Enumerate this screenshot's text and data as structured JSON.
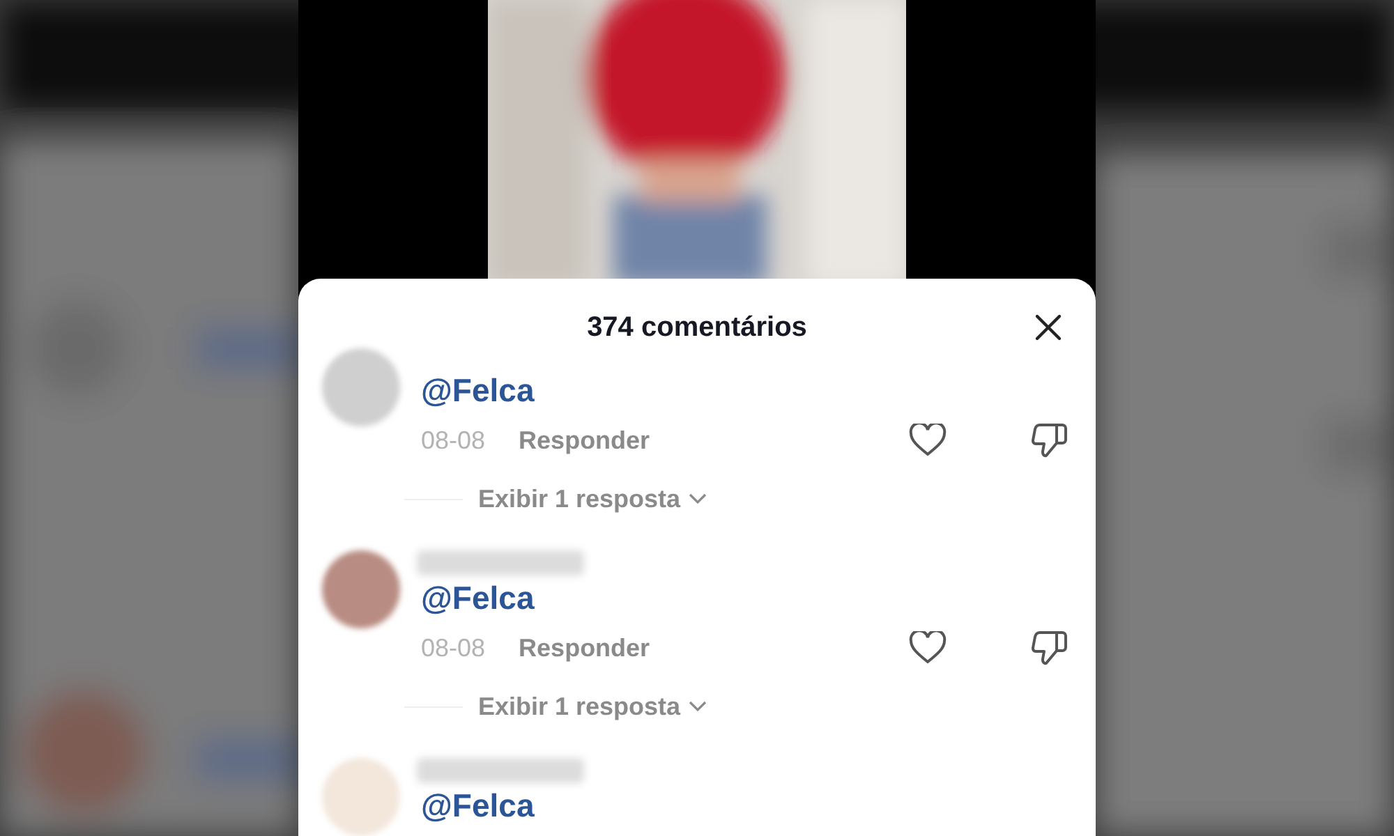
{
  "panel": {
    "title": "374 comentários"
  },
  "comments": [
    {
      "color": "#cfcfcf",
      "name_redacted": false,
      "mention": "@Felca",
      "date": "08-08",
      "reply_label": "Responder",
      "replies_label": "Exibir 1 resposta"
    },
    {
      "color": "#b88c82",
      "name_redacted": true,
      "mention": "@Felca",
      "date": "08-08",
      "reply_label": "Responder",
      "replies_label": "Exibir 1 resposta"
    },
    {
      "color": "#f3e7dc",
      "name_redacted": true,
      "mention": "@Felca"
    }
  ]
}
